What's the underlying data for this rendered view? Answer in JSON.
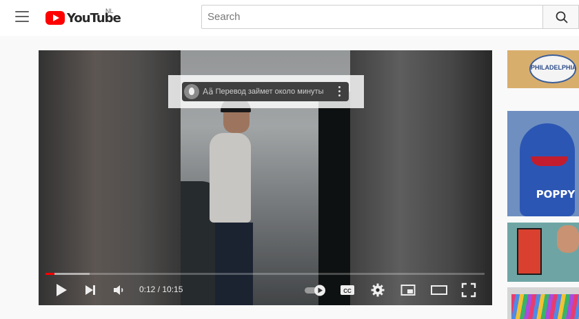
{
  "header": {
    "logo_text": "YouTube",
    "country_code": "NL",
    "search_placeholder": "Search",
    "menu_icon": "hamburger-menu-icon",
    "search_icon": "search-icon"
  },
  "translate_banner": {
    "icon": "yandex-alice-icon",
    "translate_glyph": "Aä",
    "text": "Перевод займет около минуты",
    "menu_icon": "kebab-menu-icon"
  },
  "player": {
    "current_time": "0:12",
    "duration": "10:15",
    "time_text": "0:12 / 10:15",
    "played_fraction": 0.02,
    "loaded_fraction": 0.1,
    "controls": [
      "play-icon",
      "next-icon",
      "volume-icon",
      "autoplay-toggle",
      "captions-icon",
      "settings-icon",
      "miniplayer-icon",
      "theater-icon",
      "fullscreen-icon"
    ],
    "cc_label": "CC"
  },
  "sidebar": {
    "thumbnails": [
      {
        "label": "PHILADELPHIA"
      },
      {
        "label": "POPPY"
      },
      {
        "label": ""
      },
      {
        "label": ""
      }
    ]
  },
  "colors": {
    "brand_red": "#ff0000",
    "banner_bg": "#404040"
  }
}
